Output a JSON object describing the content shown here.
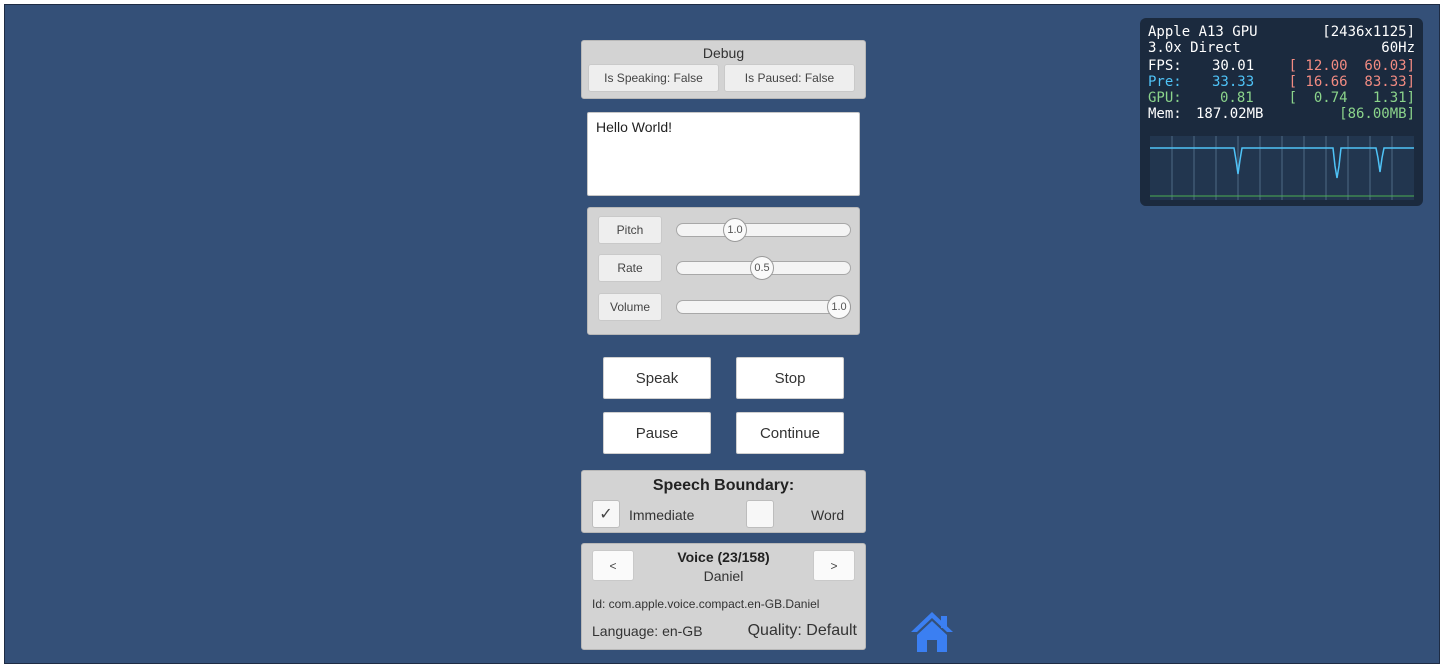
{
  "debug": {
    "title": "Debug",
    "is_speaking": "Is Speaking: False",
    "is_paused": "Is Paused: False"
  },
  "text_input": {
    "value": "Hello World!"
  },
  "sliders": [
    {
      "label": "Pitch",
      "value_text": "1.0",
      "fraction": 0.25
    },
    {
      "label": "Rate",
      "value_text": "0.5",
      "fraction": 0.5
    },
    {
      "label": "Volume",
      "value_text": "1.0",
      "fraction": 1.0
    }
  ],
  "controls": {
    "speak": "Speak",
    "stop": "Stop",
    "pause": "Pause",
    "continue": "Continue"
  },
  "boundary": {
    "title": "Speech Boundary:",
    "immediate": "Immediate",
    "immediate_checked": true,
    "check_glyph": "✓",
    "word": "Word",
    "word_checked": false
  },
  "voice": {
    "prev": "<",
    "next": ">",
    "title": "Voice (23/158)",
    "name": "Daniel",
    "id": "Id: com.apple.voice.compact.en-GB.Daniel",
    "language": "Language: en-GB",
    "quality": "Quality: Default"
  },
  "home_icon": "home-icon",
  "stats": {
    "gpu_name": "Apple A13 GPU",
    "resolution": "[2436x1125]",
    "scale_mode": "3.0x Direct",
    "refresh": "60Hz",
    "fps_label": "FPS:",
    "fps_value": "30.01",
    "fps_range": "[ 12.00  60.03]",
    "pre_label": "Pre:",
    "pre_value": "33.33",
    "pre_range": "[ 16.66  83.33]",
    "gpu_label": "GPU:",
    "gpu_value": "0.81",
    "gpu_range": "[  0.74   1.31]",
    "mem_label": "Mem:",
    "mem_value": "187.02MB",
    "mem_range": "[86.00MB]",
    "colors": {
      "fps": "#f28b82",
      "pre": "#4fc3f7",
      "gpu": "#8bd48b",
      "text": "#ffffff"
    }
  }
}
